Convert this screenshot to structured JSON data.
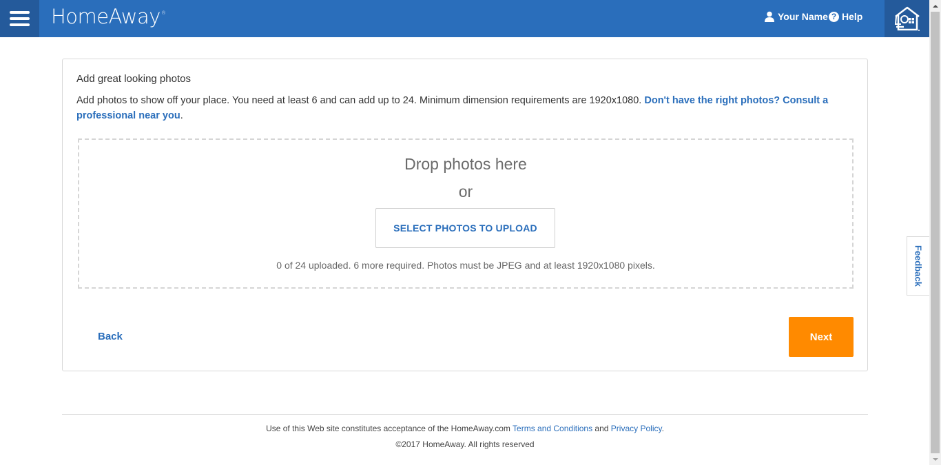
{
  "header": {
    "menu_icon": "hamburger-icon",
    "logo_text": "HomeAway",
    "logo_mark": "®",
    "user_icon": "user-icon",
    "user_label": "Your Name",
    "help_icon": "question-circle-icon",
    "help_glyph": "?",
    "help_label": "Help",
    "home_icon": "homeaway-house-icon",
    "brand_color": "#2a6ebb"
  },
  "card": {
    "title": "Add great looking photos",
    "description": "Add photos to show off your place. You need at least 6 and can add up to 24. Minimum dimension requirements are 1920x1080. ",
    "consult_link": "Don't have the right photos? Consult a professional near you",
    "description_end": "."
  },
  "dropzone": {
    "title": "Drop photos here",
    "or_text": "or",
    "select_button": "SELECT PHOTOS TO UPLOAD",
    "status": "0 of 24 uploaded. 6 more required. Photos must be JPEG and at least 1920x1080 pixels.",
    "uploaded": 0,
    "max": 24,
    "required_remaining": 6
  },
  "nav": {
    "back_label": "Back",
    "next_label": "Next",
    "next_color": "#ff8a00"
  },
  "feedback": {
    "label": "Feedback"
  },
  "footer": {
    "prefix": "Use of this Web site constitutes acceptance of the HomeAway.com ",
    "terms_link": "Terms and Conditions",
    "and_text": " and ",
    "privacy_link": "Privacy Policy",
    "suffix": ".",
    "copyright": "©2017 HomeAway. All rights reserved"
  }
}
